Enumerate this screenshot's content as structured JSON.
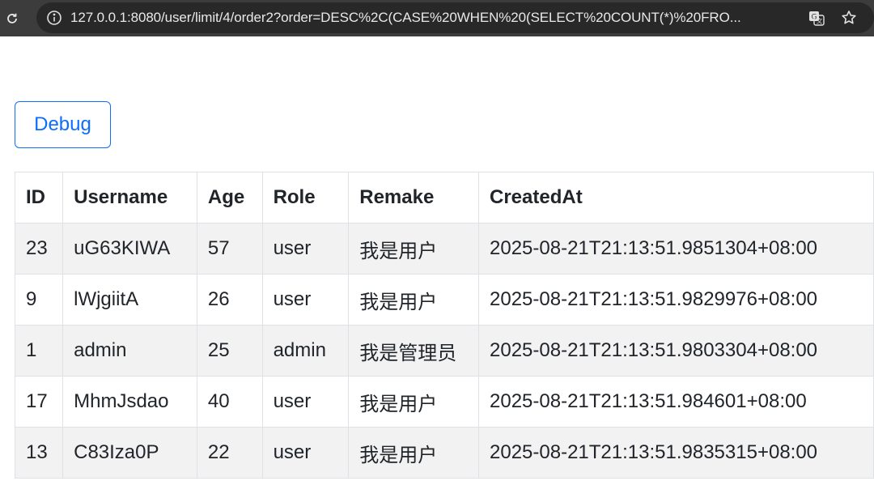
{
  "browser": {
    "url": "127.0.0.1:8080/user/limit/4/order2?order=DESC%2C(CASE%20WHEN%20(SELECT%20COUNT(*)%20FRO..."
  },
  "page": {
    "debug_label": "Debug"
  },
  "table": {
    "headers": {
      "id": "ID",
      "username": "Username",
      "age": "Age",
      "role": "Role",
      "remake": "Remake",
      "created": "CreatedAt"
    },
    "rows": [
      {
        "id": "23",
        "username": "uG63KIWA",
        "age": "57",
        "role": "user",
        "remake": "我是用户",
        "created": "2025-08-21T21:13:51.9851304+08:00"
      },
      {
        "id": "9",
        "username": "lWjgiitA",
        "age": "26",
        "role": "user",
        "remake": "我是用户",
        "created": "2025-08-21T21:13:51.9829976+08:00"
      },
      {
        "id": "1",
        "username": "admin",
        "age": "25",
        "role": "admin",
        "remake": "我是管理员",
        "created": "2025-08-21T21:13:51.9803304+08:00"
      },
      {
        "id": "17",
        "username": "MhmJsdao",
        "age": "40",
        "role": "user",
        "remake": "我是用户",
        "created": "2025-08-21T21:13:51.984601+08:00"
      },
      {
        "id": "13",
        "username": "C83Iza0P",
        "age": "22",
        "role": "user",
        "remake": "我是用户",
        "created": "2025-08-21T21:13:51.9835315+08:00"
      }
    ]
  },
  "icons": {
    "reload": "reload-icon",
    "site_info": "info-icon",
    "translate": "translate-icon",
    "bookmark": "star-icon"
  }
}
